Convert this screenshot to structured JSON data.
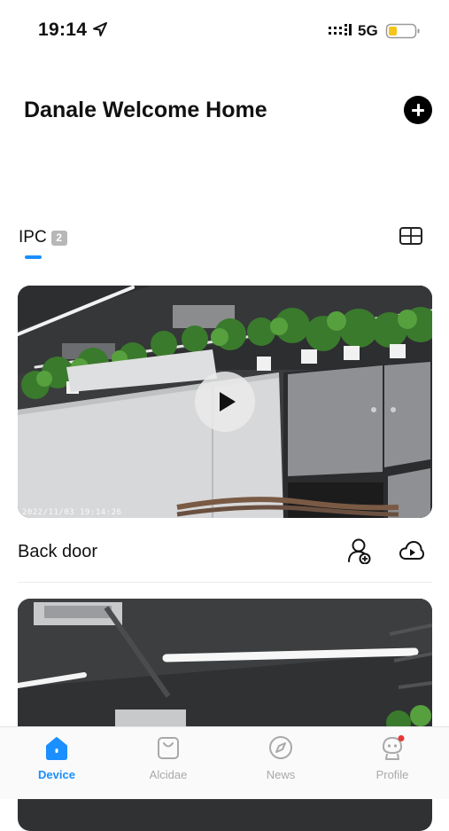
{
  "status_bar": {
    "time": "19:14",
    "network": "5G",
    "icons": [
      "location-arrow-icon",
      "signal-icon",
      "battery-icon"
    ],
    "battery_color": "#f5c518"
  },
  "header": {
    "title": "Danale Welcome Home",
    "add_icon": "plus-circle-icon"
  },
  "device_tabs": {
    "active_label": "IPC",
    "count": "2",
    "view_toggle_icon": "grid-view-icon",
    "accent_color": "#1a8fff"
  },
  "devices": [
    {
      "name": "Back door",
      "timestamp": "2022/11/03 19:14:26",
      "icons": [
        "play-icon",
        "share-user-icon",
        "cloud-playback-icon"
      ]
    },
    {
      "name": "",
      "timestamp": "",
      "icons": []
    }
  ],
  "tab_bar": {
    "items": [
      {
        "label": "Device",
        "icon": "home-icon",
        "active": true
      },
      {
        "label": "Alcidae",
        "icon": "bag-icon",
        "active": false
      },
      {
        "label": "News",
        "icon": "compass-icon",
        "active": false
      },
      {
        "label": "Profile",
        "icon": "profile-robot-icon",
        "active": false,
        "notification_dot_color": "#e53935"
      }
    ]
  }
}
